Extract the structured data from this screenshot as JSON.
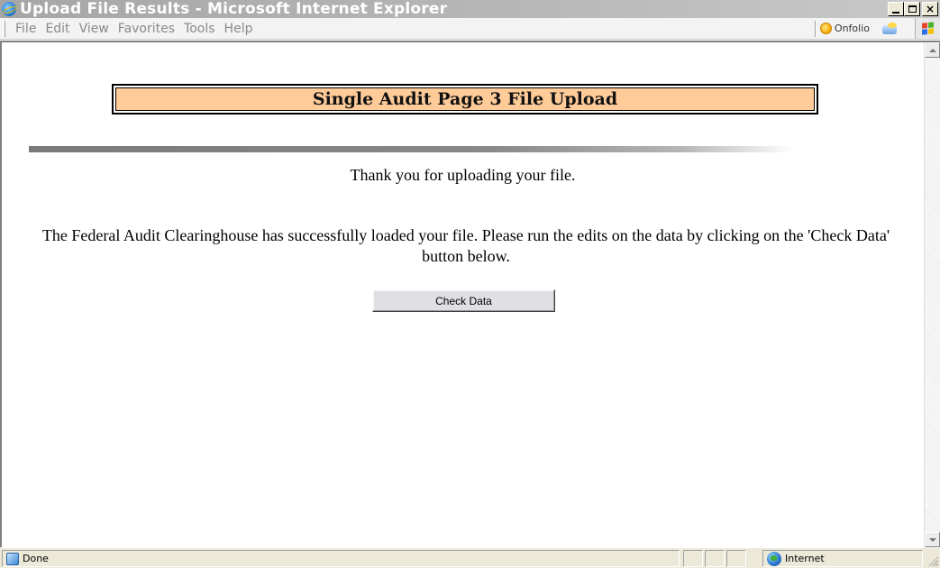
{
  "window": {
    "title": "Upload File Results - Microsoft Internet Explorer",
    "minimize_label": "",
    "maximize_label": "",
    "close_label": "×"
  },
  "menu": {
    "items": [
      "File",
      "Edit",
      "View",
      "Favorites",
      "Tools",
      "Help"
    ],
    "onfolio_label": "Onfolio"
  },
  "page": {
    "heading": "Single Audit Page 3 File Upload",
    "thanks": "Thank you for uploading your file.",
    "message": "The Federal Audit Clearinghouse has successfully loaded your file. Please run the edits on the data by clicking on the 'Check Data' button below.",
    "check_button": "Check Data",
    "header_bg": "#ffcc99"
  },
  "status": {
    "text": "Done",
    "zone": "Internet"
  },
  "icons": {
    "title": "ie-icon",
    "onfolio": "onfolio-icon",
    "status": "page-done-icon",
    "zone": "internet-globe-icon"
  }
}
